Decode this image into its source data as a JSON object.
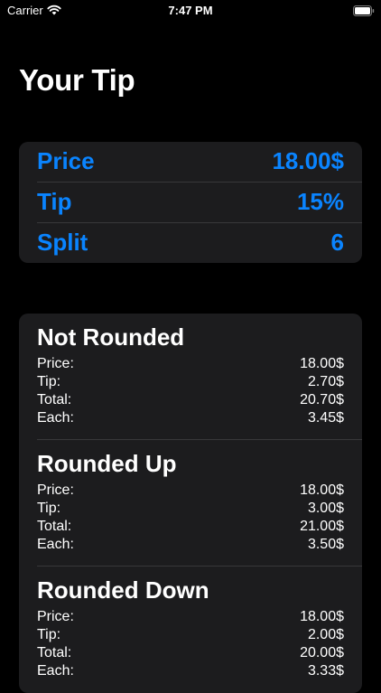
{
  "status_bar": {
    "carrier": "Carrier",
    "time": "7:47 PM",
    "wifi_icon": "wifi-icon",
    "battery_icon": "battery-full-icon"
  },
  "page": {
    "title": "Your Tip"
  },
  "colors": {
    "accent": "#0a84ff",
    "background": "#000000",
    "card": "#1c1c1e",
    "separator": "#38383a"
  },
  "inputs": {
    "price": {
      "label": "Price",
      "value": "18.00$"
    },
    "tip": {
      "label": "Tip",
      "value": "15%"
    },
    "split": {
      "label": "Split",
      "value": "6"
    }
  },
  "results": [
    {
      "title": "Not Rounded",
      "rows": [
        {
          "label": "Price:",
          "value": "18.00$"
        },
        {
          "label": "Tip:",
          "value": "2.70$"
        },
        {
          "label": "Total:",
          "value": "20.70$"
        },
        {
          "label": "Each:",
          "value": "3.45$"
        }
      ]
    },
    {
      "title": "Rounded Up",
      "rows": [
        {
          "label": "Price:",
          "value": "18.00$"
        },
        {
          "label": "Tip:",
          "value": "3.00$"
        },
        {
          "label": "Total:",
          "value": "21.00$"
        },
        {
          "label": "Each:",
          "value": "3.50$"
        }
      ]
    },
    {
      "title": "Rounded Down",
      "rows": [
        {
          "label": "Price:",
          "value": "18.00$"
        },
        {
          "label": "Tip:",
          "value": "2.00$"
        },
        {
          "label": "Total:",
          "value": "20.00$"
        },
        {
          "label": "Each:",
          "value": "3.33$"
        }
      ]
    }
  ]
}
